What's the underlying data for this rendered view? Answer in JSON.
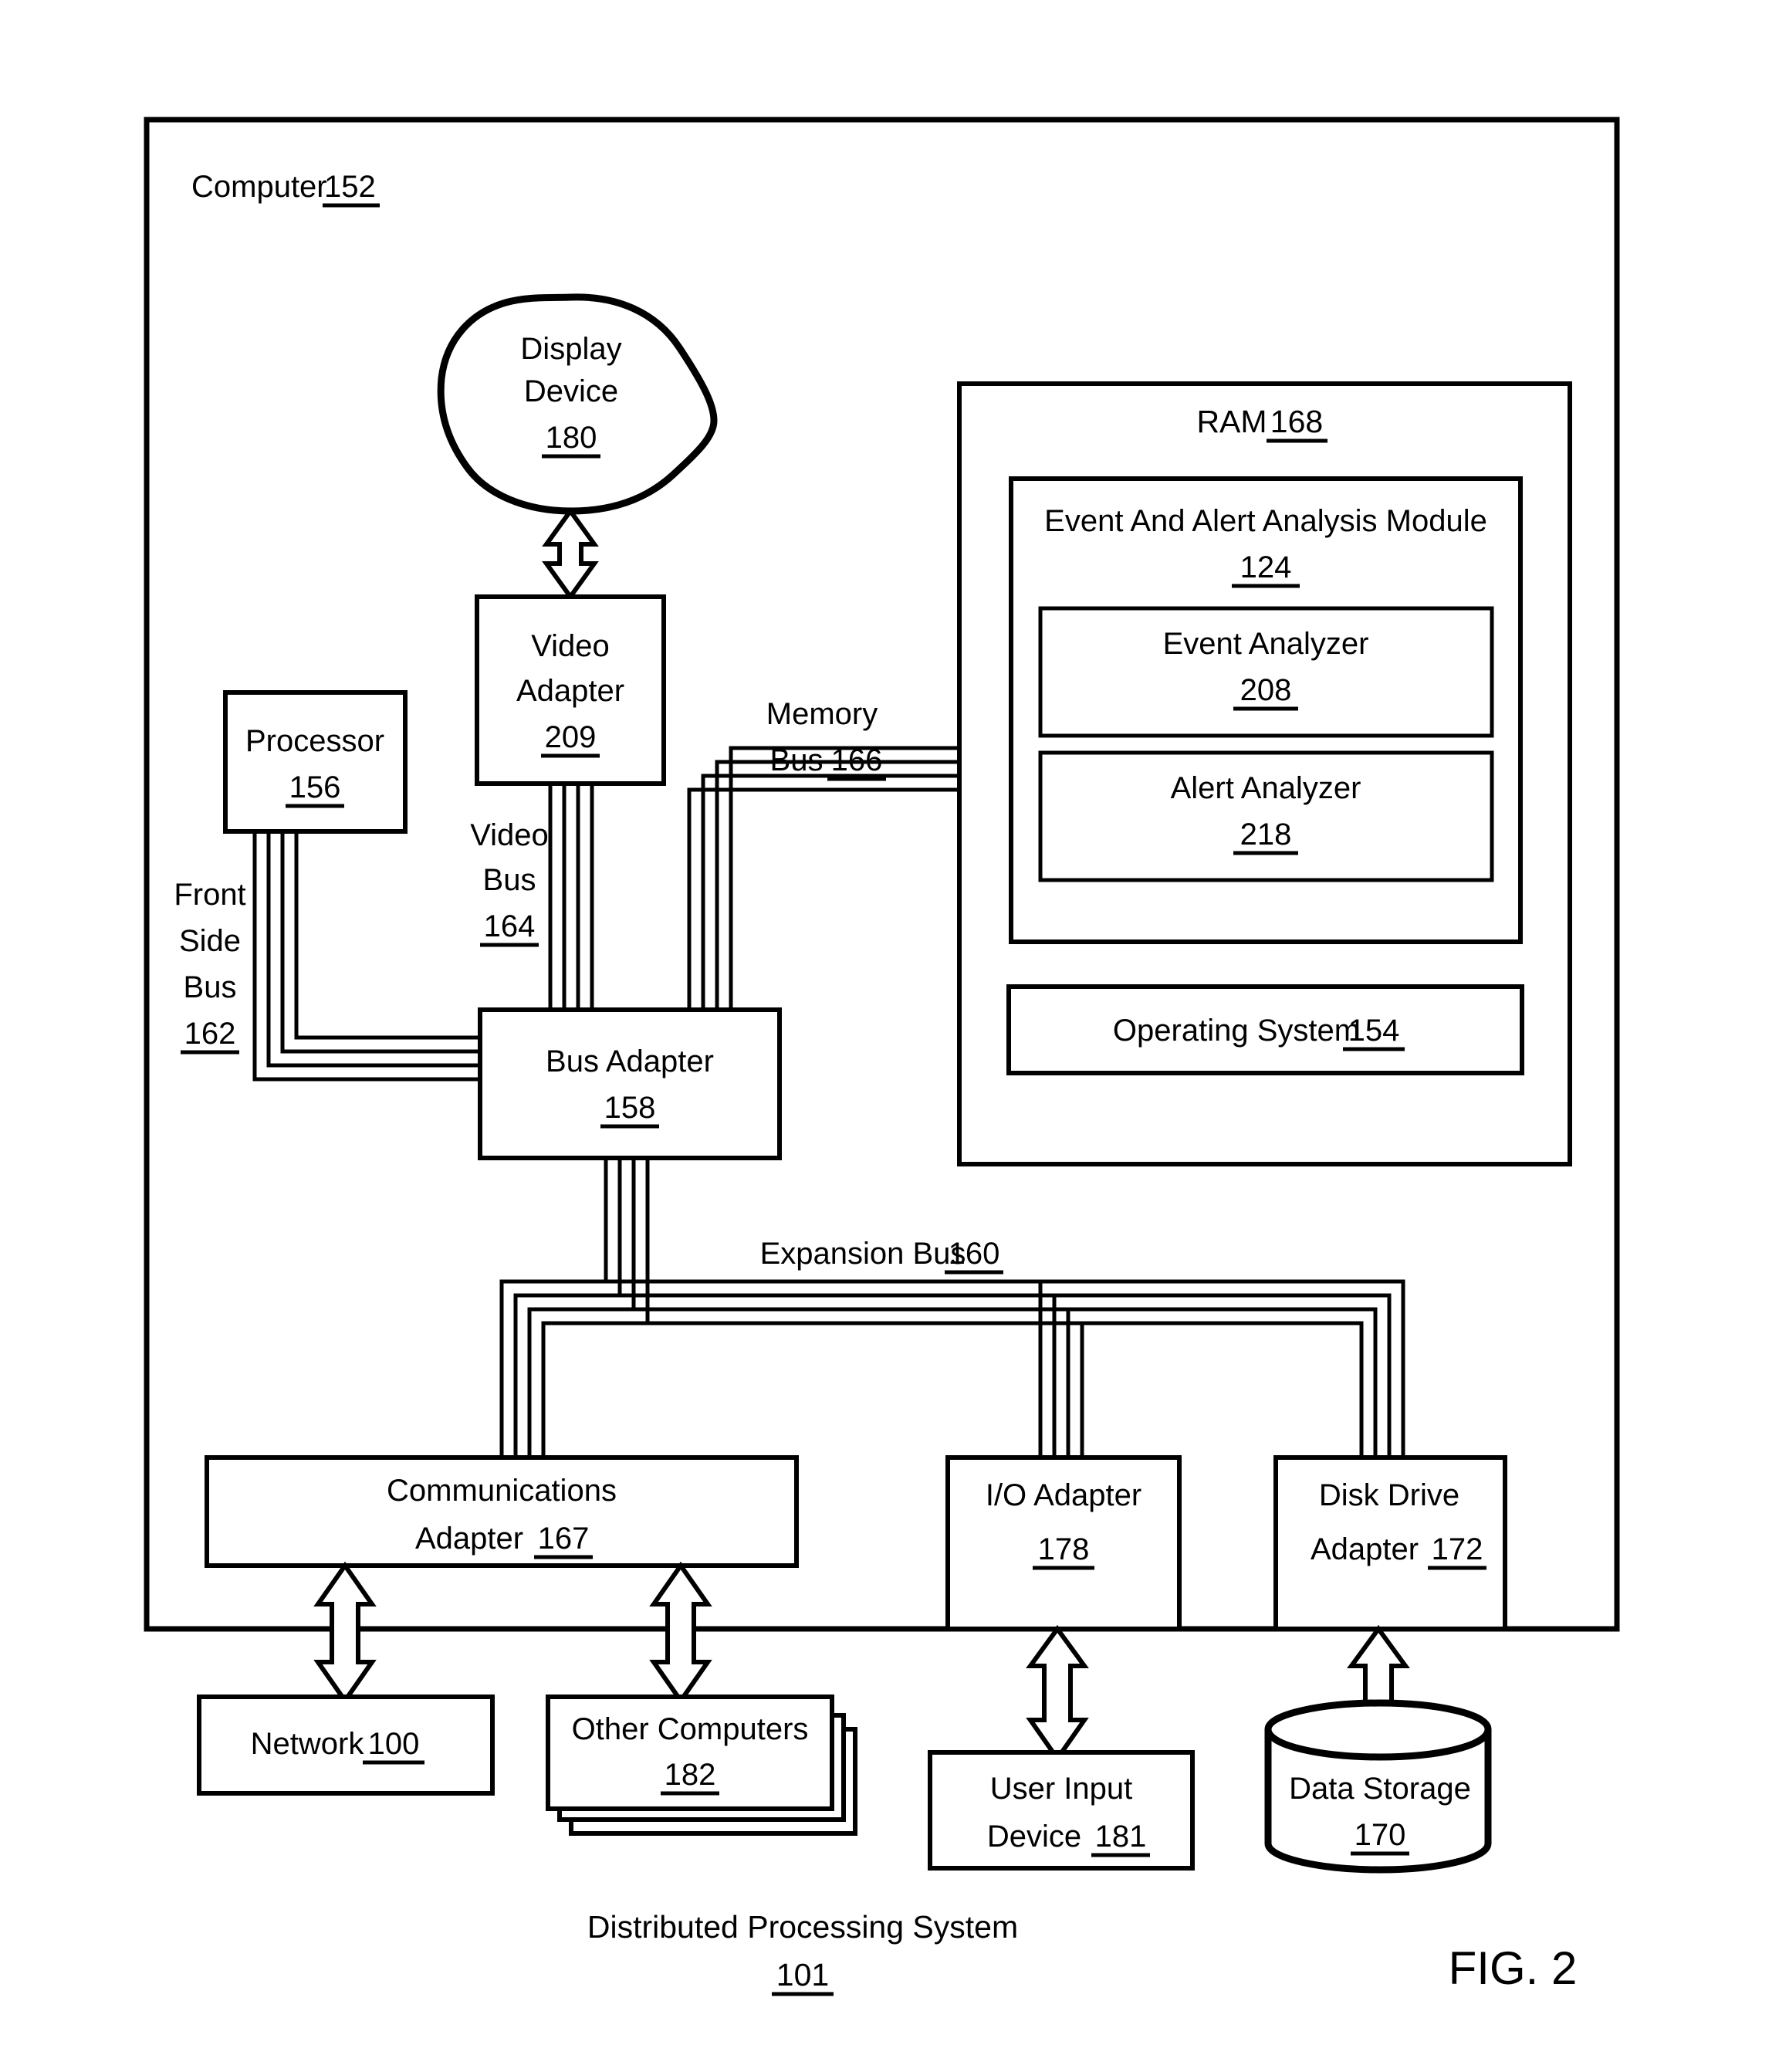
{
  "figure": {
    "label": "FIG. 2",
    "caption_title": "Distributed Processing System",
    "caption_number": "101"
  },
  "outer_container": {
    "label": "Computer",
    "number": "152"
  },
  "blocks": {
    "display_device": {
      "line1": "Display",
      "line2": "Device",
      "number": "180"
    },
    "video_adapter": {
      "line1": "Video",
      "line2": "Adapter",
      "number": "209"
    },
    "processor": {
      "line1": "Processor",
      "number": "156"
    },
    "bus_adapter": {
      "line1": "Bus Adapter",
      "number": "158"
    },
    "ram": {
      "label": "RAM",
      "number": "168"
    },
    "event_alert_module": {
      "line1": "Event And Alert Analysis Module",
      "number": "124"
    },
    "event_analyzer": {
      "line1": "Event Analyzer",
      "number": "208"
    },
    "alert_analyzer": {
      "line1": "Alert Analyzer",
      "number": "218"
    },
    "operating_system": {
      "line1": "Operating System",
      "number": "154"
    },
    "communications_adapter": {
      "line1": "Communications",
      "line2": "Adapter",
      "number": "167"
    },
    "io_adapter": {
      "line1": "I/O Adapter",
      "number": "178"
    },
    "disk_drive_adapter": {
      "line1": "Disk Drive",
      "line2": "Adapter",
      "number": "172"
    },
    "network": {
      "line1": "Network",
      "number": "100"
    },
    "other_computers": {
      "line1": "Other Computers",
      "number": "182"
    },
    "user_input_device": {
      "line1": "User Input",
      "line2": "Device",
      "number": "181"
    },
    "data_storage": {
      "line1": "Data Storage",
      "number": "170"
    }
  },
  "buses": {
    "front_side_bus": {
      "l1": "Front",
      "l2": "Side",
      "l3": "Bus",
      "number": "162"
    },
    "video_bus": {
      "l1": "Video",
      "l2": "Bus",
      "number": "164"
    },
    "memory_bus": {
      "l1": "Memory",
      "l2": "Bus",
      "number": "166"
    },
    "expansion_bus": {
      "l1": "Expansion Bus",
      "number": "160"
    }
  },
  "colors": {
    "stroke": "#000000",
    "fill": "#ffffff"
  }
}
